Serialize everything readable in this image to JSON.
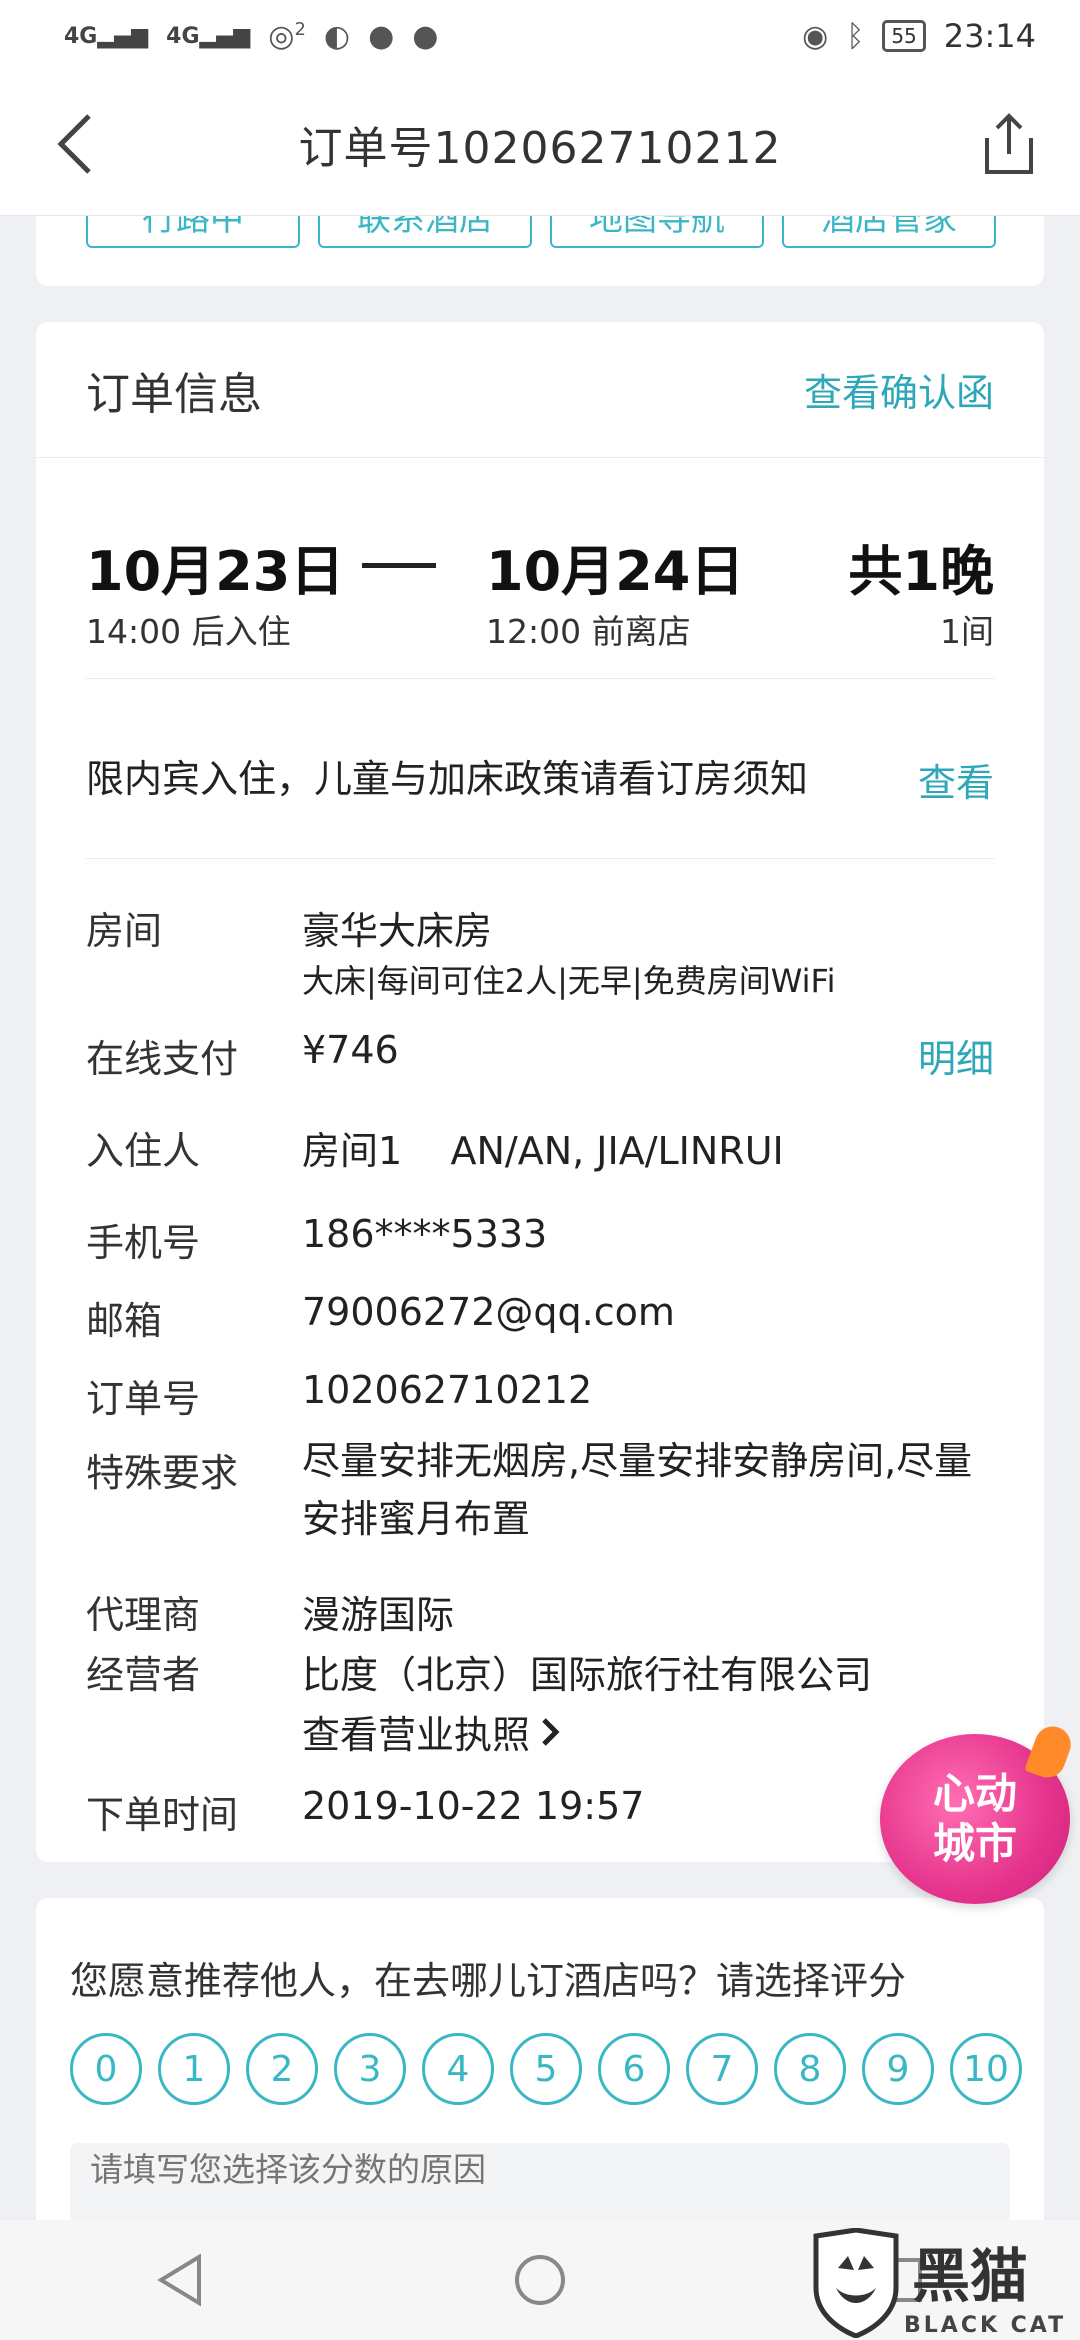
{
  "status_bar": {
    "signal1": "4G",
    "signal2": "4G",
    "hotspot_count": "2",
    "battery": "55",
    "time": "23:14"
  },
  "header": {
    "title": "订单号102062710212"
  },
  "top_buttons": [
    "行路中",
    "联系酒店",
    "地图导航",
    "酒店管家"
  ],
  "order_info": {
    "title": "订单信息",
    "confirm_link": "查看确认函",
    "checkin_date": "10月23日",
    "checkin_time": "14:00 后入住",
    "checkout_date": "10月24日",
    "checkout_time": "12:00 前离店",
    "nights": "共1晚",
    "rooms": "1间",
    "policy_text": "限内宾入住，儿童与加床政策请看订房须知",
    "policy_link": "查看",
    "room_label": "房间",
    "room_value": "豪华大床房",
    "room_detail": "大床|每间可住2人|无早|免费房间WiFi",
    "pay_label": "在线支付",
    "pay_value": "¥746",
    "pay_link": "明细",
    "guest_label": "入住人",
    "guest_value": "房间1    AN/AN, JIA/LINRUI",
    "phone_label": "手机号",
    "phone_value": "186****5333",
    "email_label": "邮箱",
    "email_value": "79006272@qq.com",
    "order_no_label": "订单号",
    "order_no_value": "102062710212",
    "special_label": "特殊要求",
    "special_value": "尽量安排无烟房,尽量安排安静房间,尽量安排蜜月布置",
    "agent_label": "代理商",
    "agent_value": "漫游国际",
    "operator_label": "经营者",
    "operator_value": "比度（北京）国际旅行社有限公司",
    "license_link": "查看营业执照",
    "order_time_label": "下单时间",
    "order_time_value": "2019-10-22 19:57"
  },
  "badge": {
    "line1": "心动",
    "line2": "城市"
  },
  "rating": {
    "question": "您愿意推荐他人，在去哪儿订酒店吗？请选择评分",
    "scores": [
      "0",
      "1",
      "2",
      "3",
      "4",
      "5",
      "6",
      "7",
      "8",
      "9",
      "10"
    ],
    "reason_placeholder": "请填写您选择该分数的原因"
  },
  "watermark": {
    "text": "黑猫",
    "sub": "BLACK CAT"
  },
  "colors": {
    "accent": "#3ab7c4",
    "link": "#2ea7b8",
    "price": "#f08c1e"
  }
}
